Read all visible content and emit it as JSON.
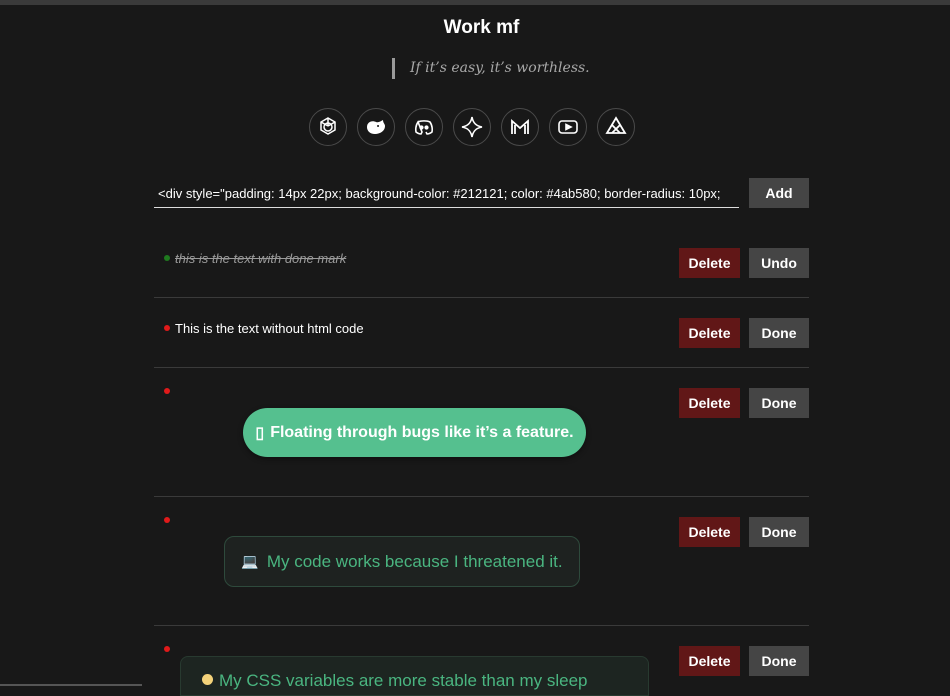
{
  "app": {
    "title": "Work mf",
    "quote": "If it’s easy, it’s worthless."
  },
  "icons": [
    {
      "name": "chatgpt-icon",
      "label": "ChatGPT"
    },
    {
      "name": "deepseek-icon",
      "label": "DeepSeek"
    },
    {
      "name": "discord-icon",
      "label": "Discord"
    },
    {
      "name": "gemini-icon",
      "label": "Gemini"
    },
    {
      "name": "gmail-icon",
      "label": "Gmail"
    },
    {
      "name": "youtube-icon",
      "label": "YouTube"
    },
    {
      "name": "qwen-icon",
      "label": "Qwen"
    }
  ],
  "input": {
    "value": "<div style=\"padding: 14px 22px; background-color: #212121; color: #4ab580; border-radius: 10px;"
  },
  "buttons": {
    "add": "Add",
    "delete": "Delete",
    "done": "Done",
    "undo": "Undo"
  },
  "tasks": [
    {
      "status": "done",
      "text": "this is the text with done mark"
    },
    {
      "status": "pending",
      "text": "This is the text without html code"
    },
    {
      "status": "pending",
      "html_text": "Floating through bugs like it’s a feature.",
      "glyph": "▯"
    },
    {
      "status": "pending",
      "html_text": "My code works because I threatened it.",
      "glyph": "💻"
    },
    {
      "status": "pending",
      "html_text": "My CSS variables are more stable than my sleep"
    }
  ],
  "colors": {
    "background": "#181818",
    "delete": "#611717",
    "neutral": "#454545",
    "accent_green": "#4ab580",
    "pill_green": "#55c08f",
    "pending_dot": "#e01a1a",
    "done_dot": "#1f7a1f"
  }
}
